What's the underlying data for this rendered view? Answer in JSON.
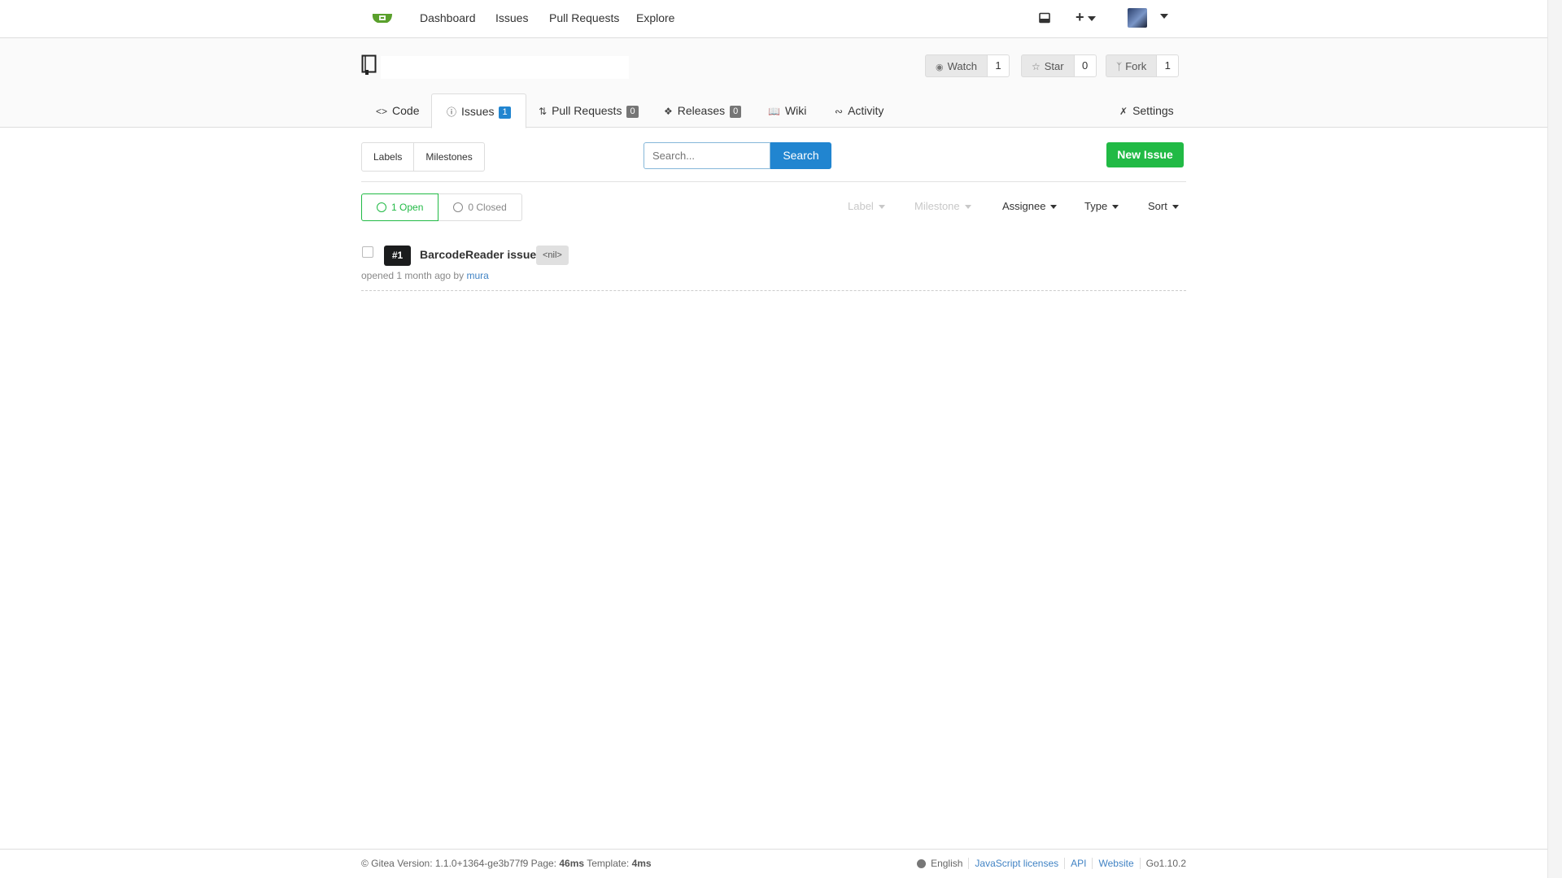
{
  "nav": {
    "dashboard": "Dashboard",
    "issues": "Issues",
    "pull_requests": "Pull Requests",
    "explore": "Explore",
    "create": "+"
  },
  "repo": {
    "watch_label": "Watch",
    "watch_count": "1",
    "star_label": "Star",
    "star_count": "0",
    "fork_label": "Fork",
    "fork_count": "1"
  },
  "tabs": {
    "code": "Code",
    "issues": "Issues",
    "issues_count": "1",
    "pulls": "Pull Requests",
    "pulls_count": "0",
    "releases": "Releases",
    "releases_count": "0",
    "wiki": "Wiki",
    "activity": "Activity",
    "settings": "Settings"
  },
  "toolbar": {
    "labels": "Labels",
    "milestones": "Milestones",
    "search_placeholder": "Search...",
    "search_button": "Search",
    "new_issue": "New Issue"
  },
  "states": {
    "open": "1 Open",
    "closed": "0 Closed"
  },
  "filters": {
    "label": "Label",
    "milestone": "Milestone",
    "assignee": "Assignee",
    "type": "Type",
    "sort": "Sort"
  },
  "issues": [
    {
      "number": "#1",
      "title": "BarcodeReader issues",
      "label": "<nil>",
      "meta_prefix": "opened 1 month ago by",
      "author": "mura"
    }
  ],
  "footer": {
    "version_prefix": "© Gitea Version: 1.1.0+1364-ge3b77f9 Page:",
    "page_time": "46ms",
    "template_prefix": "Template:",
    "template_time": "4ms",
    "language": "English",
    "js_licenses": "JavaScript licenses",
    "api": "API",
    "website": "Website",
    "go_version": "Go1.10.2"
  },
  "colors": {
    "brand_green": "#21ba45",
    "primary_blue": "#2185d0",
    "link_blue": "#4183c4"
  }
}
